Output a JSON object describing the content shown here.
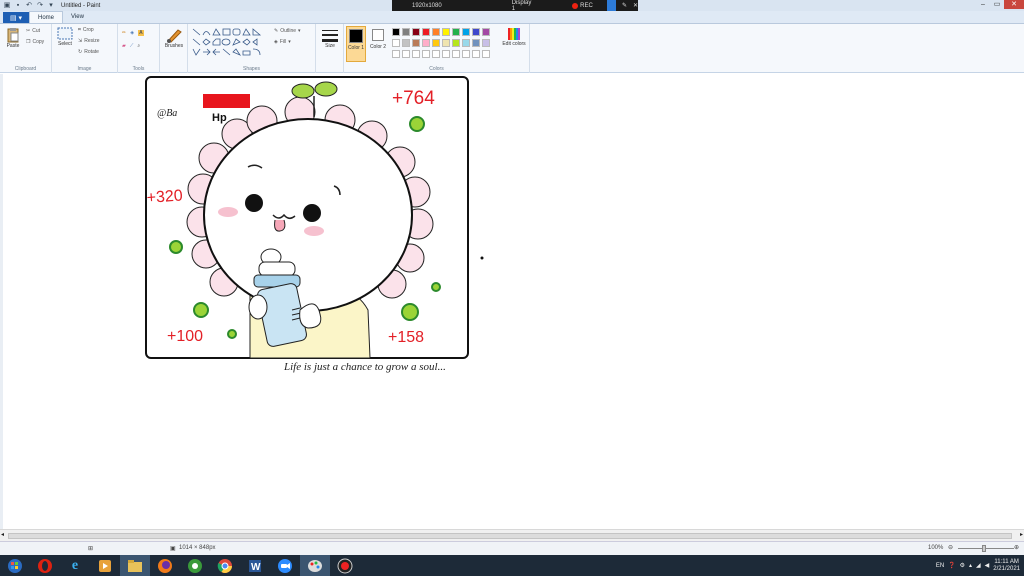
{
  "window": {
    "title": "Untitled - Paint",
    "recorder": {
      "resolution": "1920x1080",
      "display": "Display 1",
      "rec_label": "REC"
    }
  },
  "ribbon": {
    "tabs": [
      {
        "label": "Home",
        "active": true
      },
      {
        "label": "View",
        "active": false
      }
    ],
    "clipboard": {
      "paste": "Paste",
      "cut": "Cut",
      "copy": "Copy",
      "group": "Clipboard"
    },
    "image": {
      "select": "Select",
      "crop": "Crop",
      "resize": "Resize",
      "rotate": "Rotate",
      "group": "Image"
    },
    "tools": {
      "group": "Tools"
    },
    "brushes": {
      "label": "Brushes"
    },
    "shapes": {
      "outline": "Outline",
      "fill": "Fill",
      "group": "Shapes"
    },
    "size": {
      "label": "Size"
    },
    "colors": {
      "color1": "Color 1",
      "color2": "Color 2",
      "edit": "Edit colors",
      "group": "Colors",
      "color1_value": "#000000",
      "color2_value": "#ffffff",
      "palette_row1": [
        "#000000",
        "#7f7f7f",
        "#880015",
        "#ed1c24",
        "#ff7f27",
        "#fff200",
        "#22b14c",
        "#00a2e8",
        "#3f48cc",
        "#a349a4"
      ],
      "palette_row2": [
        "#ffffff",
        "#c3c3c3",
        "#b97a57",
        "#ffaec9",
        "#ffc90e",
        "#efe4b0",
        "#b5e61d",
        "#99d9ea",
        "#7092be",
        "#c8bfe7"
      ],
      "palette_row3": [
        "#ffffff",
        "#ffffff",
        "#ffffff",
        "#ffffff",
        "#ffffff",
        "#ffffff",
        "#ffffff",
        "#ffffff",
        "#ffffff",
        "#ffffff"
      ]
    }
  },
  "drawing": {
    "signature": "@Ba",
    "hp_label": "Hp",
    "scores": {
      "top_right": "+764",
      "left": "+320",
      "bottom_left": "+100",
      "bottom_right": "+158"
    },
    "caption": "Life is just a chance to grow a soul..."
  },
  "status": {
    "image_size": "1014 × 848px",
    "zoom": "100%"
  },
  "taskbar": {
    "apps": [
      "start-icon",
      "opera-icon",
      "ie-icon",
      "media-player-icon",
      "explorer-icon",
      "cleaner-icon",
      "chrome-icon",
      "word-icon",
      "zoom-icon",
      "paint-icon",
      "recorder-icon"
    ],
    "tray": {
      "lang": "EN",
      "time": "11:11 AM",
      "date": "2/21/2021"
    }
  }
}
